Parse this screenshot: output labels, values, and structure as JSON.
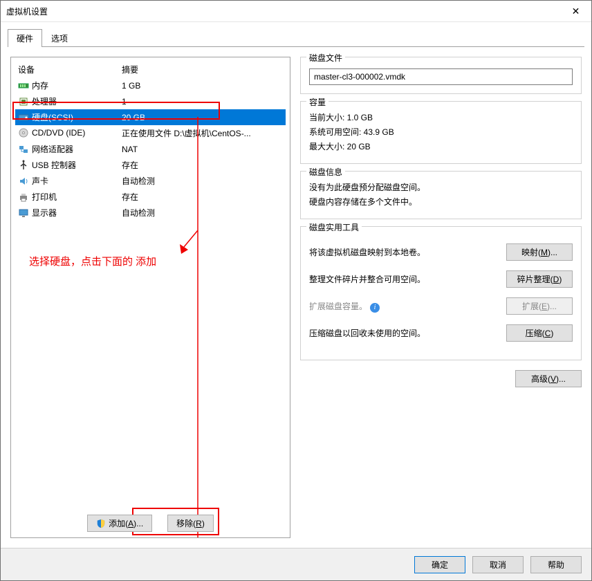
{
  "window": {
    "title": "虚拟机设置",
    "close": "✕"
  },
  "tabs": {
    "hardware": "硬件",
    "options": "选项"
  },
  "device_headers": {
    "device": "设备",
    "summary": "摘要"
  },
  "devices": [
    {
      "icon": "memory-icon",
      "name": "内存",
      "summary": "1 GB"
    },
    {
      "icon": "cpu-icon",
      "name": "处理器",
      "summary": "1"
    },
    {
      "icon": "disk-icon",
      "name": "硬盘(SCSI)",
      "summary": "20 GB"
    },
    {
      "icon": "cd-icon",
      "name": "CD/DVD (IDE)",
      "summary": "正在使用文件 D:\\虚拟机\\CentOS-..."
    },
    {
      "icon": "net-icon",
      "name": "网络适配器",
      "summary": "NAT"
    },
    {
      "icon": "usb-icon",
      "name": "USB 控制器",
      "summary": "存在"
    },
    {
      "icon": "sound-icon",
      "name": "声卡",
      "summary": "自动检测"
    },
    {
      "icon": "printer-icon",
      "name": "打印机",
      "summary": "存在"
    },
    {
      "icon": "display-icon",
      "name": "显示器",
      "summary": "自动检测"
    }
  ],
  "annotation": "选择硬盘，点击下面的 添加",
  "left_buttons": {
    "add": "添加(A)...",
    "remove": "移除(R)"
  },
  "disk_file": {
    "title": "磁盘文件",
    "value": "master-cl3-000002.vmdk"
  },
  "capacity": {
    "title": "容量",
    "current": "当前大小: 1.0 GB",
    "free": "系统可用空间: 43.9 GB",
    "max": "最大大小: 20 GB"
  },
  "disk_info": {
    "title": "磁盘信息",
    "line1": "没有为此硬盘预分配磁盘空间。",
    "line2": "硬盘内容存储在多个文件中。"
  },
  "utilities": {
    "title": "磁盘实用工具",
    "map_label": "将该虚拟机磁盘映射到本地卷。",
    "map_btn": "映射(M)...",
    "defrag_label": "整理文件碎片并整合可用空间。",
    "defrag_btn": "碎片整理(D)",
    "expand_label": "扩展磁盘容量。",
    "expand_btn": "扩展(E)...",
    "compact_label": "压缩磁盘以回收未使用的空间。",
    "compact_btn": "压缩(C)"
  },
  "advanced_btn": "高级(V)...",
  "footer": {
    "ok": "确定",
    "cancel": "取消",
    "help": "帮助"
  }
}
